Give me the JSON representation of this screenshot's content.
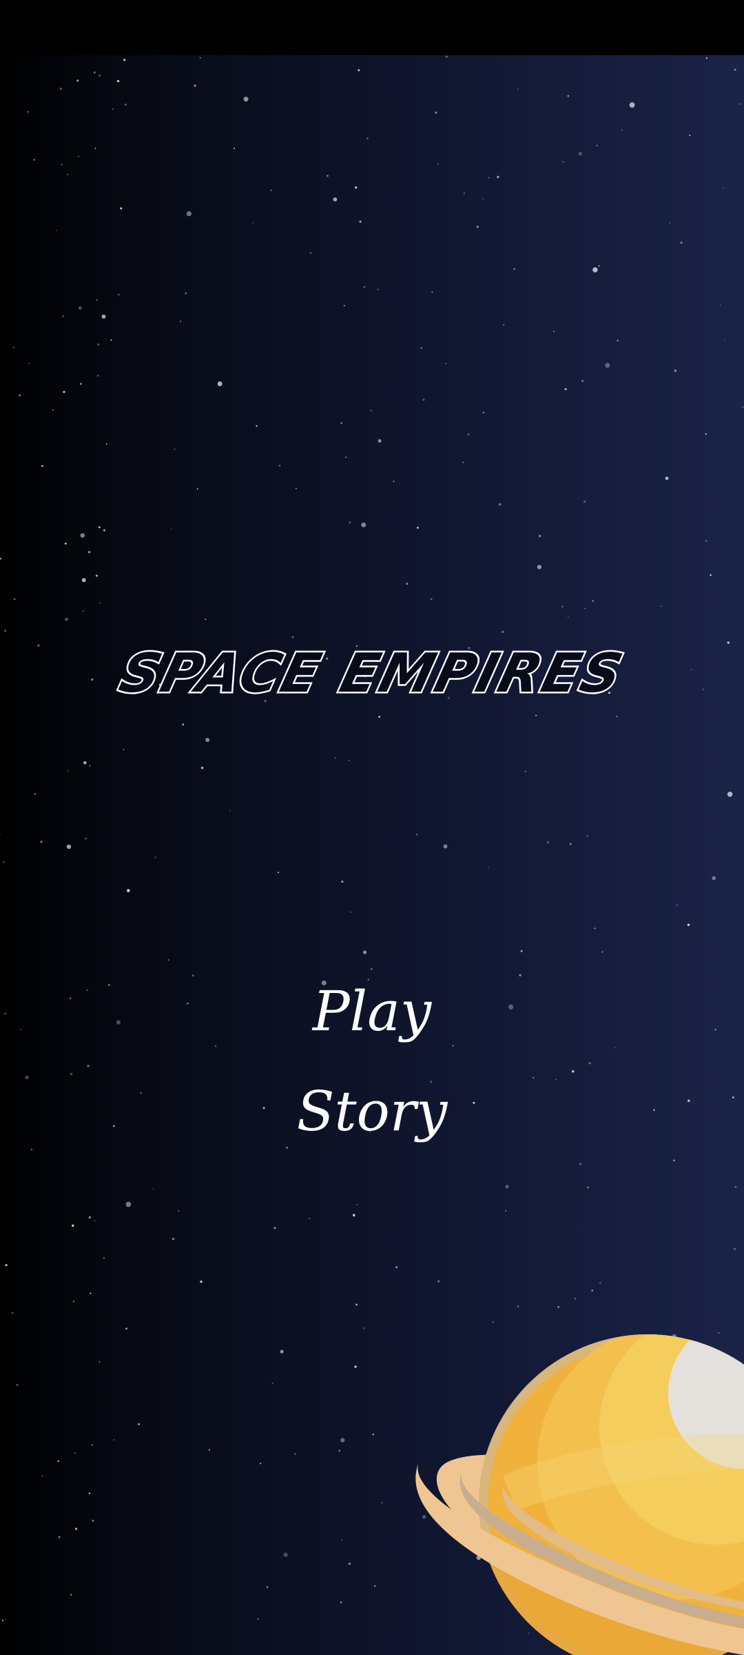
{
  "game": {
    "title": "SPACE EMPIRES"
  },
  "menu": {
    "play_label": "Play",
    "story_label": "Story"
  },
  "colors": {
    "background_dark": "#000000",
    "background_light": "#1b2348",
    "title_outline": "#ffffff",
    "menu_text": "#ffffff",
    "planet_body": "#f0b23c",
    "planet_ring": "#efc692"
  },
  "decorations": {
    "starfield": "star-field",
    "planet": "ringed-planet-icon"
  }
}
